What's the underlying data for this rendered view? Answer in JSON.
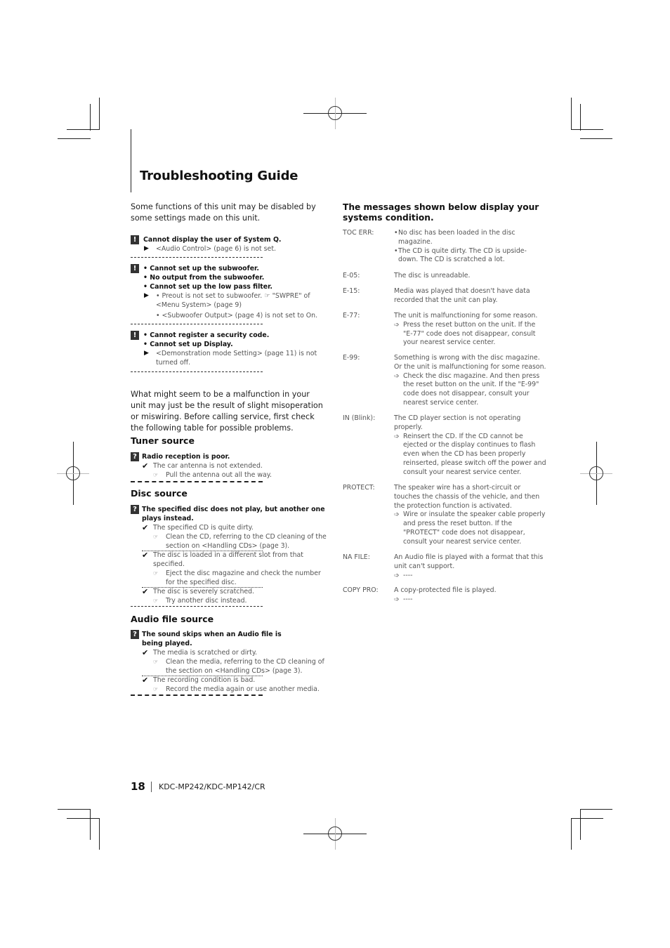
{
  "page": {
    "title": "Troubleshooting Guide",
    "intro": "Some functions of this unit may be disabled by some settings made on this unit.",
    "warnings": [
      {
        "icon": "exclamation-icon",
        "headings": [
          "Cannot display the user of System Q."
        ],
        "remedies": [
          "<Audio Control> (page 6) is not set."
        ]
      },
      {
        "icon": "exclamation-icon",
        "headings": [
          "• Cannot set up the subwoofer.",
          "• No output from the subwoofer.",
          "• Cannot set up the low pass filter."
        ],
        "remedies": [
          "• Preout is not set to subwoofer. ☞ \"SWPRE\" of <Menu System> (page 9)",
          "• <Subwoofer Output> (page 4) is not set to On."
        ]
      },
      {
        "icon": "exclamation-icon",
        "headings": [
          "• Cannot register a security code.",
          "• Cannot set up Display."
        ],
        "remedies": [
          "<Demonstration mode Setting> (page 11) is not turned off."
        ]
      }
    ],
    "malfunction_intro": "What might seem to be a malfunction in your unit may just be the result of slight misoperation or miswiring. Before calling service, first check the following table for possible problems.",
    "sections": [
      {
        "title": "Tuner source",
        "problems": [
          {
            "question": "Radio reception is poor.",
            "causes": [
              {
                "cause": "The car antenna is not extended.",
                "remedy": "Pull the antenna out all the way."
              }
            ]
          }
        ]
      },
      {
        "title": "Disc source",
        "problems": [
          {
            "question": "The specified disc does not play, but another one plays instead.",
            "causes": [
              {
                "cause": "The specified CD is quite dirty.",
                "remedy": "Clean the CD, referring to the CD cleaning of the section on <Handling CDs> (page 3)."
              },
              {
                "cause": "The disc is loaded in a different slot from that specified.",
                "remedy": "Eject the disc magazine and check the number for the specified disc."
              },
              {
                "cause": "The disc is severely scratched.",
                "remedy": "Try another disc instead."
              }
            ]
          }
        ]
      },
      {
        "title": "Audio file source",
        "problems": [
          {
            "question": "The sound skips when an Audio file is being played.",
            "causes": [
              {
                "cause": "The media is scratched or dirty.",
                "remedy": "Clean the media, referring to the CD cleaning of the section on <Handling CDs> (page 3)."
              },
              {
                "cause": "The recording condition is bad.",
                "remedy": "Record the media again or use another media."
              }
            ]
          }
        ]
      }
    ],
    "messages_heading": "The messages shown below display your systems condition.",
    "messages": [
      {
        "code": "TOC ERR:",
        "bullets": [
          "No disc has been loaded in the disc magazine.",
          "The CD is quite dirty. The CD is upside-down. The CD is scratched a lot."
        ]
      },
      {
        "code": "E-05:",
        "desc": "The disc is unreadable."
      },
      {
        "code": "E-15:",
        "desc": "Media was played that doesn't have data recorded that the unit can play."
      },
      {
        "code": "E-77:",
        "desc": "The unit is malfunctioning for some reason.",
        "action": "Press the reset button on the unit. If the \"E-77\" code does not disappear, consult your nearest service center."
      },
      {
        "code": "E-99:",
        "desc": "Something is wrong with the disc magazine. Or the unit is malfunctioning for some reason.",
        "action": "Check the disc magazine. And then press the reset button on the unit. If the \"E-99\" code does not disappear, consult your nearest service center."
      },
      {
        "code": "IN (Blink):",
        "desc": "The CD player section is not operating properly.",
        "action": "Reinsert the CD. If the CD cannot be ejected or the display continues to flash even when the CD has been properly reinserted, please switch off the power and consult your nearest service center."
      },
      {
        "code": "PROTECT:",
        "desc": "The speaker wire has a short-circuit or touches the chassis of the vehicle, and then the protection function is activated.",
        "action": "Wire or insulate the speaker cable properly and press the reset button. If the \"PROTECT\" code does not disappear, consult your nearest service center."
      },
      {
        "code": "NA FILE:",
        "desc": "An Audio file is played with a format that this unit can't support.",
        "action": "----"
      },
      {
        "code": "COPY PRO:",
        "desc": "A copy-protected file is played.",
        "action": "----"
      }
    ],
    "footer": {
      "page_number": "18",
      "model": "KDC-MP242/KDC-MP142/CR"
    }
  },
  "glyphs": {
    "exclamation": "!",
    "question": "?",
    "triangle": "▶",
    "check": "✔",
    "hand": "☞",
    "arrow": "➩"
  }
}
